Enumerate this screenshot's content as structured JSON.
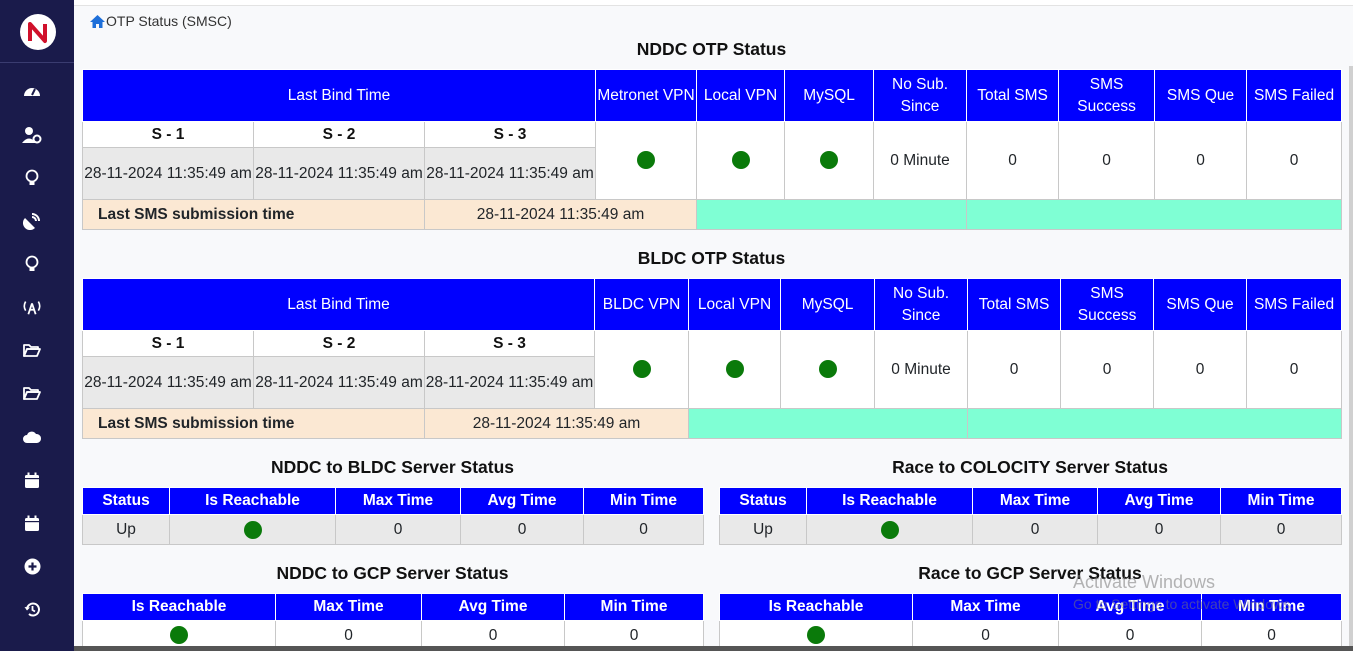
{
  "breadcrumb": {
    "label": "OTP Status (SMSC)"
  },
  "nddc": {
    "title": "NDDC OTP Status",
    "headers": {
      "last_bind": "Last Bind Time",
      "vpn": "Metronet VPN",
      "local_vpn": "Local VPN",
      "mysql": "MySQL",
      "no_sub": "No Sub. Since",
      "total": "Total SMS",
      "success": "SMS Success",
      "que": "SMS Que",
      "failed": "SMS Failed"
    },
    "servers": [
      {
        "name": "S - 1",
        "time": "28-11-2024 11:35:49 am"
      },
      {
        "name": "S - 2",
        "time": "28-11-2024 11:35:49 am"
      },
      {
        "name": "S - 3",
        "time": "28-11-2024 11:35:49 am"
      }
    ],
    "values": {
      "no_sub": "0 Minute",
      "total": "0",
      "success": "0",
      "que": "0",
      "failed": "0"
    },
    "last_sms_label": "Last SMS submission time",
    "last_sms_value": "28-11-2024 11:35:49 am"
  },
  "bldc": {
    "title": "BLDC OTP Status",
    "headers": {
      "last_bind": "Last Bind Time",
      "vpn": "BLDC VPN",
      "local_vpn": "Local VPN",
      "mysql": "MySQL",
      "no_sub": "No Sub. Since",
      "total": "Total SMS",
      "success": "SMS Success",
      "que": "SMS Que",
      "failed": "SMS Failed"
    },
    "servers": [
      {
        "name": "S - 1",
        "time": "28-11-2024 11:35:49 am"
      },
      {
        "name": "S - 2",
        "time": "28-11-2024 11:35:49 am"
      },
      {
        "name": "S - 3",
        "time": "28-11-2024 11:35:49 am"
      }
    ],
    "values": {
      "no_sub": "0 Minute",
      "total": "0",
      "success": "0",
      "que": "0",
      "failed": "0"
    },
    "last_sms_label": "Last SMS submission time",
    "last_sms_value": "28-11-2024 11:35:49 am"
  },
  "nddc_bldc": {
    "title": "NDDC to BLDC Server Status",
    "headers": [
      "Status",
      "Is Reachable",
      "Max Time",
      "Avg Time",
      "Min Time"
    ],
    "row": {
      "status": "Up",
      "max": "0",
      "avg": "0",
      "min": "0"
    }
  },
  "race_colocity": {
    "title": "Race to COLOCITY Server Status",
    "headers": [
      "Status",
      "Is Reachable",
      "Max Time",
      "Avg Time",
      "Min Time"
    ],
    "row": {
      "status": "Up",
      "max": "0",
      "avg": "0",
      "min": "0"
    }
  },
  "nddc_gcp": {
    "title": "NDDC to GCP Server Status",
    "headers": [
      "Is Reachable",
      "Max Time",
      "Avg Time",
      "Min Time"
    ],
    "row": {
      "max": "0",
      "avg": "0",
      "min": "0"
    }
  },
  "race_gcp": {
    "title": "Race to GCP Server Status",
    "headers": [
      "Is Reachable",
      "Max Time",
      "Avg Time",
      "Min Time"
    ],
    "row": {
      "max": "0",
      "avg": "0",
      "min": "0"
    }
  },
  "watermark": {
    "line1": "Activate Windows",
    "line2": "Go to Settings to activate Windows."
  },
  "colors": {
    "sidebar": "#1a1b4b",
    "header_blue": "#0000ff",
    "status_green": "#0a7a0a",
    "mint": "#7fffd4",
    "peach": "#fbe8d3"
  },
  "sidebar_icons": [
    "dashboard-icon",
    "user-gear-icon",
    "lightbulb-icon",
    "satellite-dish-icon",
    "lightbulb-icon",
    "tower-broadcast-icon",
    "folder-open-icon",
    "folder-open-icon",
    "cloud-icon",
    "calendar-icon",
    "calendar-icon",
    "plus-circle-icon",
    "history-icon"
  ]
}
